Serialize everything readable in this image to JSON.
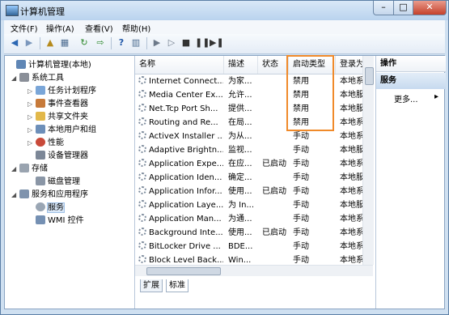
{
  "window": {
    "title": "计算机管理",
    "close_glyph": "✕",
    "max_glyph": "□",
    "min_glyph": "–"
  },
  "menu": [
    "文件(F)",
    "操作(A)",
    "查看(V)",
    "帮助(H)"
  ],
  "toolbar_icons": [
    "back-arrow-icon",
    "forward-arrow-icon",
    "up-folder-icon",
    "show-tree-icon",
    "refresh-icon",
    "export-icon",
    "help-icon",
    "console-icon",
    "play-icon",
    "play-alt-icon",
    "stop-icon",
    "pause-icon",
    "restart-icon"
  ],
  "tree": [
    {
      "label": "计算机管理(本地)",
      "level": 0,
      "icon": "computer-icon",
      "arrow": ""
    },
    {
      "label": "系统工具",
      "level": 1,
      "icon": "tools-icon",
      "arrow": "◢"
    },
    {
      "label": "任务计划程序",
      "level": 2,
      "icon": "clock-icon",
      "arrow": "▷"
    },
    {
      "label": "事件查看器",
      "level": 2,
      "icon": "event-viewer-icon",
      "arrow": "▷"
    },
    {
      "label": "共享文件夹",
      "level": 2,
      "icon": "shared-folder-icon",
      "arrow": "▷"
    },
    {
      "label": "本地用户和组",
      "level": 2,
      "icon": "users-icon",
      "arrow": "▷"
    },
    {
      "label": "性能",
      "level": 2,
      "icon": "performance-icon",
      "arrow": "▷"
    },
    {
      "label": "设备管理器",
      "level": 2,
      "icon": "device-manager-icon",
      "arrow": ""
    },
    {
      "label": "存储",
      "level": 1,
      "icon": "storage-icon",
      "arrow": "◢"
    },
    {
      "label": "磁盘管理",
      "level": 2,
      "icon": "disk-icon",
      "arrow": ""
    },
    {
      "label": "服务和应用程序",
      "level": 1,
      "icon": "apps-icon",
      "arrow": "◢"
    },
    {
      "label": "服务",
      "level": 2,
      "icon": "services-icon",
      "arrow": "",
      "selected": true
    },
    {
      "label": "WMI 控件",
      "level": 2,
      "icon": "wmi-icon",
      "arrow": ""
    }
  ],
  "columns": [
    "名称",
    "描述",
    "状态",
    "启动类型",
    "登录为"
  ],
  "rows": [
    [
      "Internet Connect...",
      "为家...",
      "",
      "禁用",
      "本地系"
    ],
    [
      "Media Center Ex...",
      "允许...",
      "",
      "禁用",
      "本地服"
    ],
    [
      "Net.Tcp Port Sh...",
      "提供...",
      "",
      "禁用",
      "本地服"
    ],
    [
      "Routing and Re...",
      "在局...",
      "",
      "禁用",
      "本地系"
    ],
    [
      "ActiveX Installer ...",
      "为从...",
      "",
      "手动",
      "本地系"
    ],
    [
      "Adaptive Brightn...",
      "监视...",
      "",
      "手动",
      "本地服"
    ],
    [
      "Application Expe...",
      "在应...",
      "已启动",
      "手动",
      "本地系"
    ],
    [
      "Application Iden...",
      "确定...",
      "",
      "手动",
      "本地服"
    ],
    [
      "Application Infor...",
      "使用...",
      "已启动",
      "手动",
      "本地系"
    ],
    [
      "Application Laye...",
      "为 In...",
      "",
      "手动",
      "本地服"
    ],
    [
      "Application Man...",
      "为通...",
      "",
      "手动",
      "本地系"
    ],
    [
      "Background Inte...",
      "使用...",
      "已启动",
      "手动",
      "本地系"
    ],
    [
      "BitLocker Drive ...",
      "BDE...",
      "",
      "手动",
      "本地系"
    ],
    [
      "Block Level Back...",
      "Win...",
      "",
      "手动",
      "本地系"
    ]
  ],
  "tabs": [
    "扩展",
    "标准"
  ],
  "actions": {
    "header": "操作",
    "section": "服务",
    "more": "更多..."
  },
  "colors": {
    "highlight": "#f08a2a"
  }
}
